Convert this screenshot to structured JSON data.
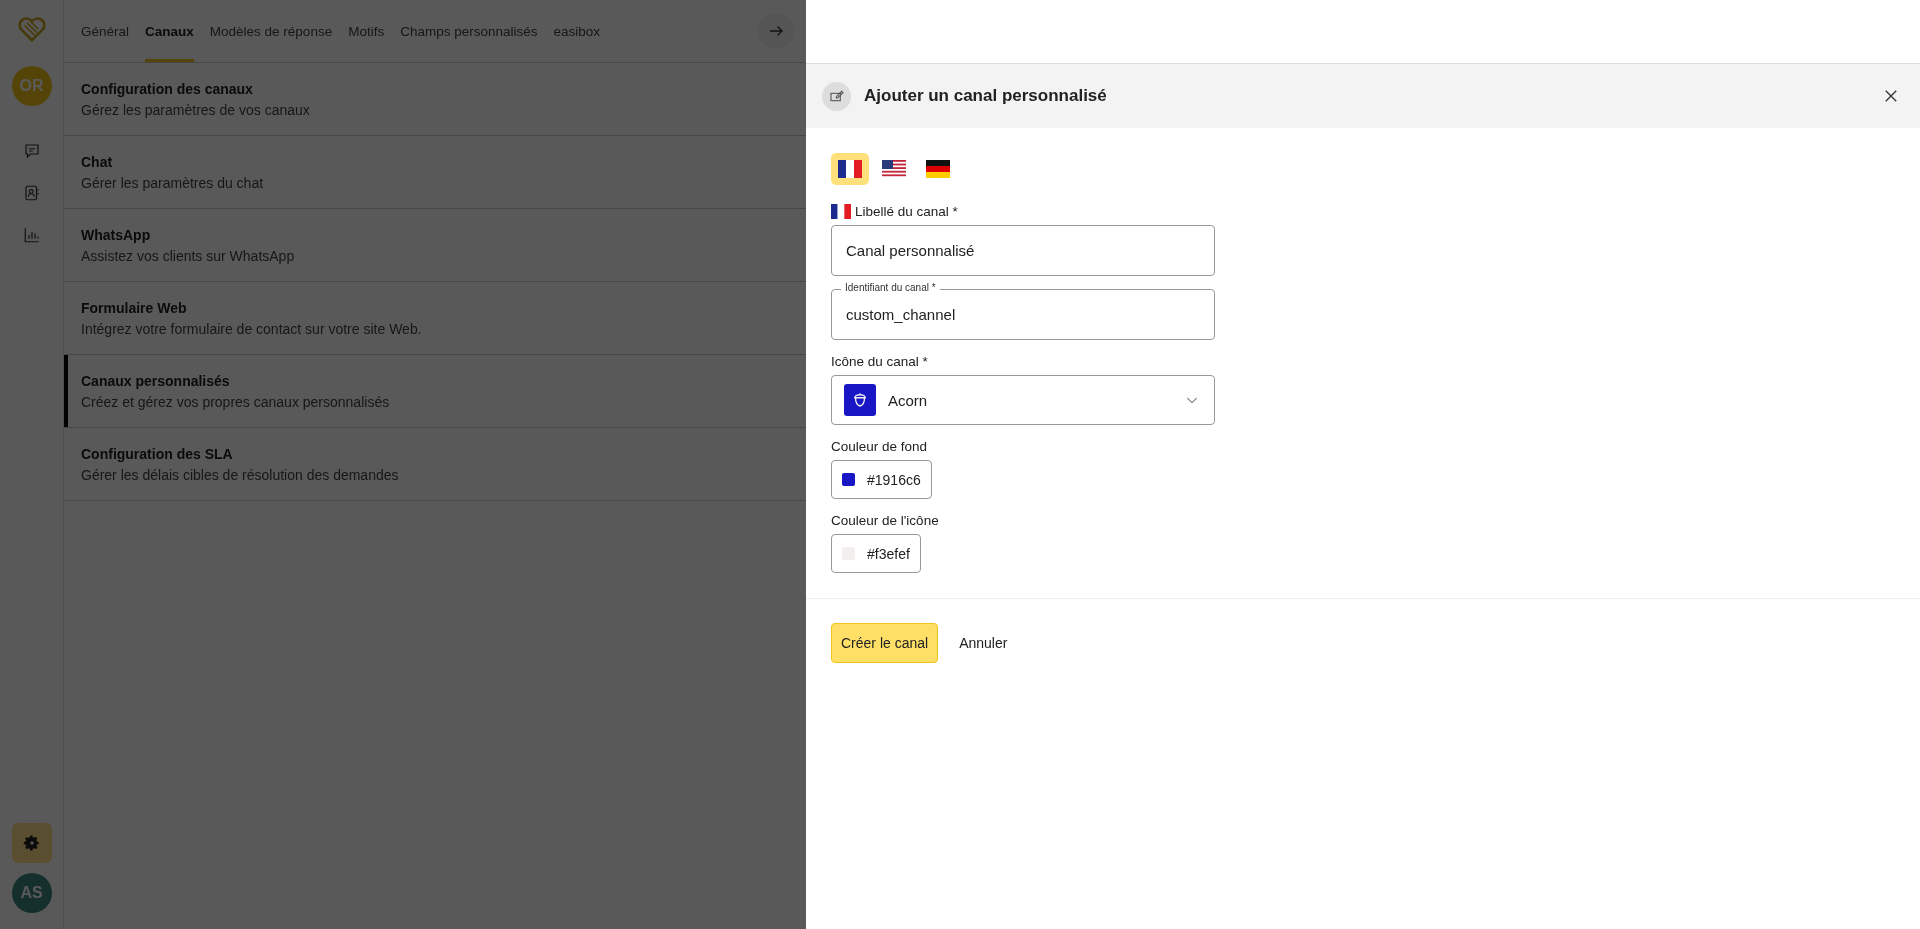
{
  "sidebar": {
    "user_initials": "OR",
    "items": [
      {
        "kind": "chat",
        "selected": false
      },
      {
        "kind": "contacts",
        "selected": false
      },
      {
        "kind": "stats",
        "selected": false
      }
    ],
    "settings_selected": true,
    "bottom_initials": "AS"
  },
  "tabs": [
    {
      "label": "Général",
      "selected": false
    },
    {
      "label": "Canaux",
      "selected": true
    },
    {
      "label": "Modèles de réponse",
      "selected": false
    },
    {
      "label": "Motifs",
      "selected": false
    },
    {
      "label": "Champs personnalisés",
      "selected": false
    },
    {
      "label": "easibox",
      "selected": false
    }
  ],
  "settings_list": [
    {
      "title": "Configuration des canaux",
      "description": "Gérez les paramètres de vos canaux",
      "selected": false
    },
    {
      "title": "Chat",
      "description": "Gérer les paramètres du chat",
      "selected": false
    },
    {
      "title": "WhatsApp",
      "description": "Assistez vos clients sur WhatsApp",
      "selected": false
    },
    {
      "title": "Formulaire Web",
      "description": "Intégrez votre formulaire de contact sur votre site Web.",
      "selected": false
    },
    {
      "title": "Canaux personnalisés",
      "description": "Créez et gérez vos propres canaux personnalisés",
      "selected": true
    },
    {
      "title": "Configuration des SLA",
      "description": "Gérer les délais cibles de résolution des demandes",
      "selected": false
    }
  ],
  "panel": {
    "title": "Ajouter un canal personnalisé",
    "languages": [
      {
        "kind": "fr",
        "selected": true
      },
      {
        "kind": "us",
        "selected": false
      },
      {
        "kind": "de",
        "selected": false
      }
    ],
    "label_field": {
      "kind": "fr",
      "label": "Libellé du canal *",
      "value": "Canal personnalisé"
    },
    "id_field": {
      "label": "Identifiant du canal *",
      "value": "custom_channel"
    },
    "icon_field": {
      "label": "Icône du canal *",
      "value": "Acorn"
    },
    "colors": [
      {
        "label": "Couleur de fond",
        "value": "#1916c6",
        "color": "#1916c6"
      },
      {
        "label": "Couleur de l'icône",
        "value": "#f3efef",
        "color": "#f3efef"
      }
    ],
    "buttons": [
      {
        "kind": "primary",
        "label": "Créer le canal"
      },
      {
        "kind": "secondary",
        "label": "Annuler"
      }
    ]
  }
}
